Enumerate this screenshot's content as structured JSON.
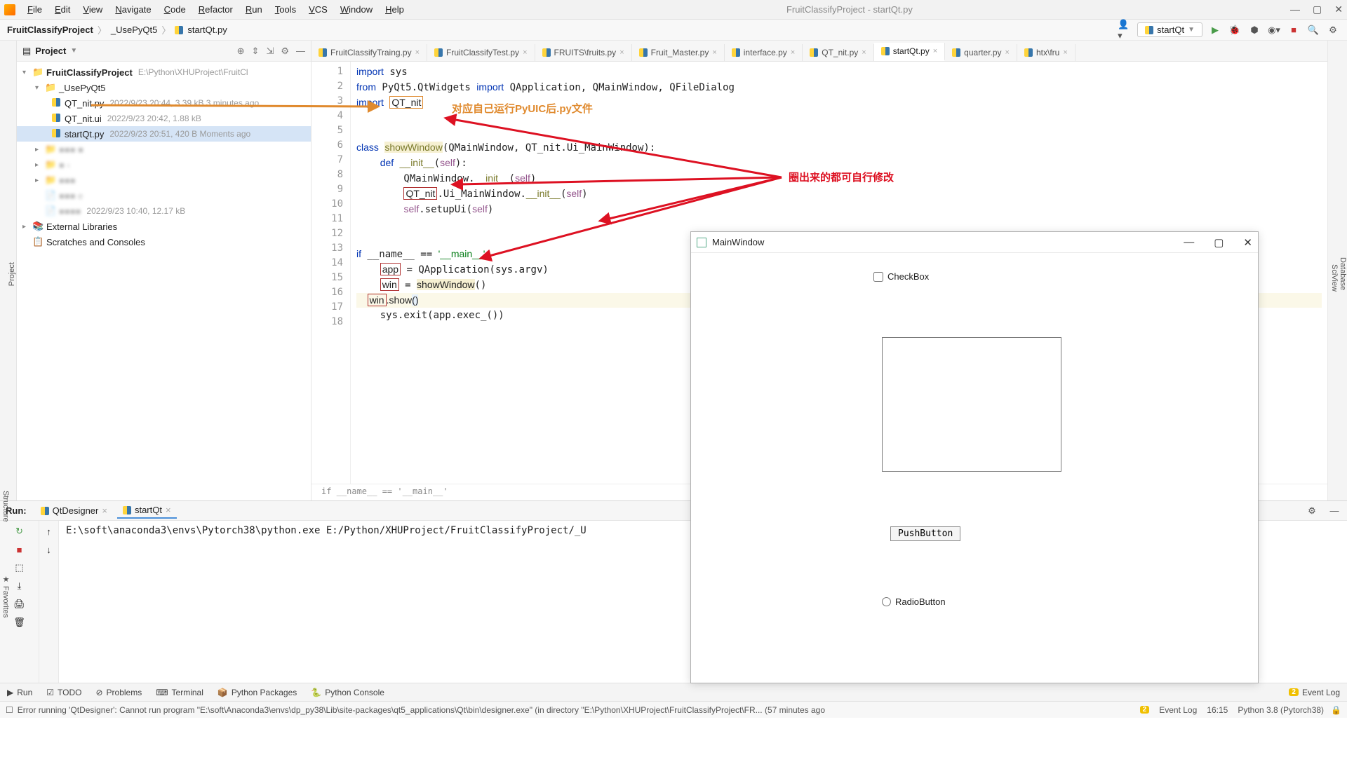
{
  "titlebar": {
    "menus": [
      "File",
      "Edit",
      "View",
      "Navigate",
      "Code",
      "Refactor",
      "Run",
      "Tools",
      "VCS",
      "Window",
      "Help"
    ],
    "title": "FruitClassifyProject - startQt.py"
  },
  "navbar": {
    "crumbs": [
      "FruitClassifyProject",
      "_UsePyQt5",
      "startQt.py"
    ],
    "run_config": "startQt"
  },
  "project": {
    "label": "Project",
    "root": {
      "name": "FruitClassifyProject",
      "path": "E:\\Python\\XHUProject\\FruitCl"
    },
    "folder": "_UsePyQt5",
    "files": [
      {
        "name": "QT_nit.py",
        "meta": "2022/9/23 20:44, 3.39 kB 3 minutes ago"
      },
      {
        "name": "QT_nit.ui",
        "meta": "2022/9/23 20:42, 1.88 kB"
      },
      {
        "name": "startQt.py",
        "meta": "2022/9/23 20:51, 420 B Moments ago",
        "sel": true
      }
    ],
    "ext_lib": "External Libraries",
    "scratch": "Scratches and Consoles"
  },
  "tabs": [
    {
      "label": "FruitClassifyTraing.py"
    },
    {
      "label": "FruitClassifyTest.py"
    },
    {
      "label": "FRUITS\\fruits.py"
    },
    {
      "label": "Fruit_Master.py"
    },
    {
      "label": "interface.py"
    },
    {
      "label": "QT_nit.py"
    },
    {
      "label": "startQt.py",
      "active": true
    },
    {
      "label": "quarter.py"
    },
    {
      "label": "htx\\fru"
    }
  ],
  "code": {
    "lines_count": 18,
    "breadcrumb": "if __name__ == '__main__'"
  },
  "annotations": {
    "orange_text": "对应自己运行PyUIC后.py文件",
    "red_text": "圈出来的都可自行修改"
  },
  "run": {
    "label": "Run:",
    "tabs": [
      {
        "label": "QtDesigner"
      },
      {
        "label": "startQt",
        "active": true
      }
    ],
    "output": "E:\\soft\\anaconda3\\envs\\Pytorch38\\python.exe  E:/Python/XHUProject/FruitClassifyProject/_U"
  },
  "qtwindow": {
    "title": "MainWindow",
    "checkbox": "CheckBox",
    "pushbutton": "PushButton",
    "radiobutton": "RadioButton"
  },
  "bottomtabs": [
    "Run",
    "TODO",
    "Problems",
    "Terminal",
    "Python Packages",
    "Python Console"
  ],
  "statusbar": {
    "msg": "Error running 'QtDesigner': Cannot run program \"E:\\soft\\Anaconda3\\envs\\dp_py38\\Lib\\site-packages\\qt5_applications\\Qt\\bin\\designer.exe\" (in directory \"E:\\Python\\XHUProject\\FruitClassifyProject\\FR... (57 minutes ago",
    "event_log": "Event Log",
    "caret": "16:15",
    "interpreter": "Python 3.8 (Pytorch38)"
  }
}
